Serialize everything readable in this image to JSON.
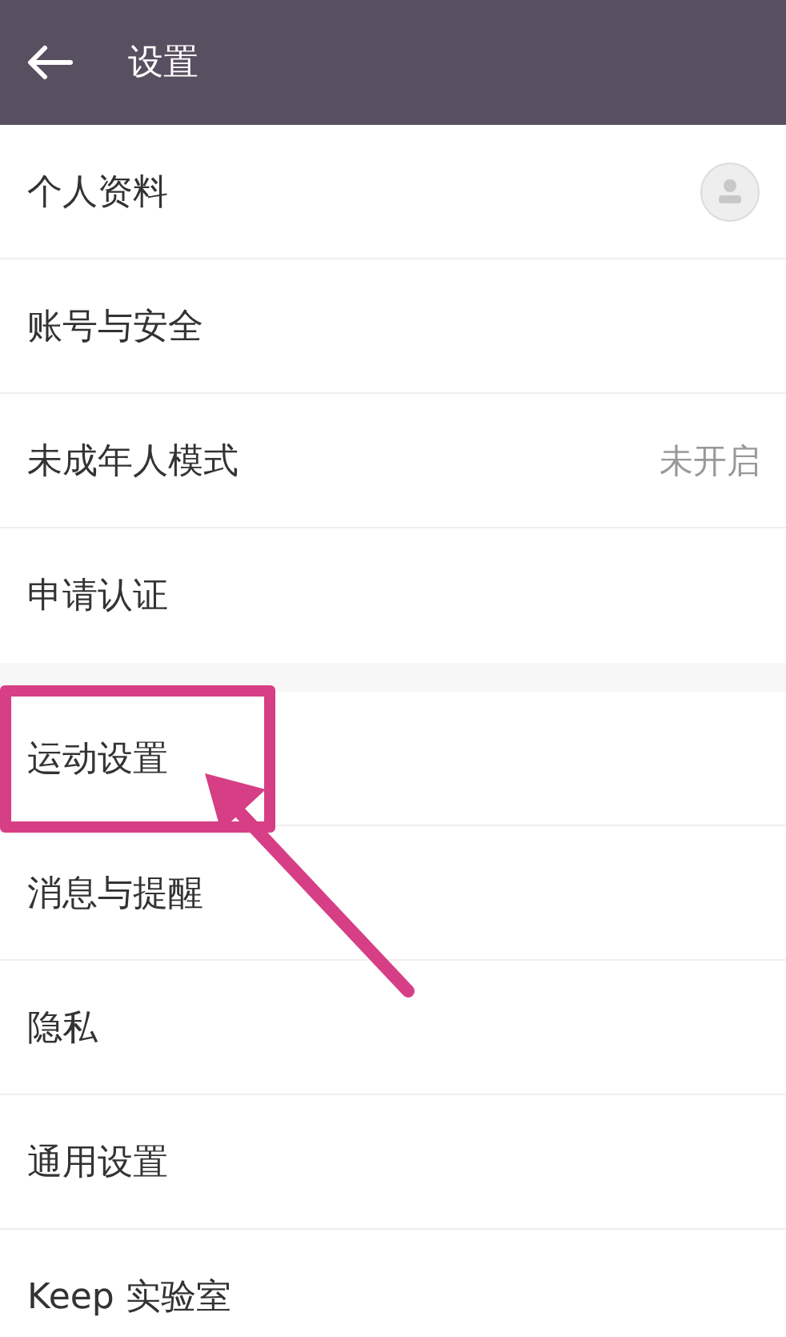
{
  "header": {
    "title": "设置"
  },
  "groups": [
    {
      "items": [
        {
          "kind": "avatar",
          "label": "个人资料",
          "highlighted": false
        },
        {
          "kind": "plain",
          "label": "账号与安全",
          "highlighted": false
        },
        {
          "kind": "value",
          "label": "未成年人模式",
          "value": "未开启",
          "highlighted": false
        },
        {
          "kind": "plain",
          "label": "申请认证",
          "highlighted": false
        }
      ]
    },
    {
      "items": [
        {
          "kind": "plain",
          "label": "运动设置",
          "highlighted": true
        },
        {
          "kind": "plain",
          "label": "消息与提醒",
          "highlighted": false
        },
        {
          "kind": "plain",
          "label": "隐私",
          "highlighted": false
        },
        {
          "kind": "plain",
          "label": "通用设置",
          "highlighted": false
        },
        {
          "kind": "plain",
          "label": "Keep 实验室",
          "highlighted": false
        }
      ]
    }
  ]
}
